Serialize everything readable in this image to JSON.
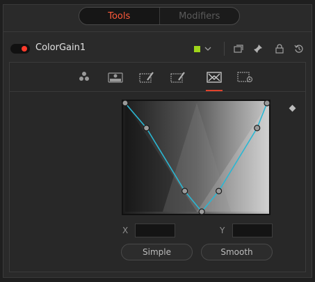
{
  "header_tabs": [
    {
      "label": "Tools",
      "active": true
    },
    {
      "label": "Modifiers",
      "active": false
    }
  ],
  "tool": {
    "name": "ColorGain1",
    "enabled": true,
    "color_swatch": "#9fd51a",
    "header_icons": [
      "color-swatch-icon",
      "chevron-down-icon",
      "window-icon",
      "pin-icon",
      "lock-icon",
      "reset-icon"
    ]
  },
  "inspector_tabs": [
    {
      "icon": "gain-color-dots-icon",
      "active": false
    },
    {
      "icon": "saturation-icon",
      "active": false
    },
    {
      "icon": "color-ranges-icon",
      "active": false
    },
    {
      "icon": "color-ranges-alt-icon",
      "active": false
    },
    {
      "icon": "curve-ranges-icon",
      "active": true
    },
    {
      "icon": "settings-icon",
      "active": false
    }
  ],
  "curve": {
    "line_color": "#2ab7d3",
    "handles": [
      [
        0,
        0
      ],
      [
        0.15,
        0.23
      ],
      [
        0.42,
        0.81
      ],
      [
        0.54,
        1.0
      ],
      [
        0.66,
        0.81
      ],
      [
        0.93,
        0.23
      ],
      [
        1.0,
        0
      ]
    ]
  },
  "xy": {
    "x_label": "X",
    "y_label": "Y",
    "x_value": "",
    "y_value": ""
  },
  "buttons": {
    "simple": "Simple",
    "smooth": "Smooth"
  }
}
